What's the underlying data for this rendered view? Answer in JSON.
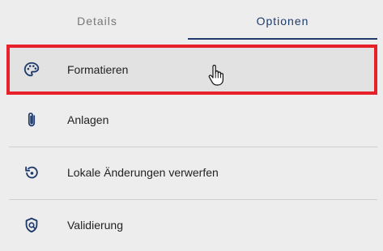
{
  "tabs": {
    "details": "Details",
    "options": "Optionen"
  },
  "items": [
    {
      "label": "Formatieren",
      "icon": "palette-icon"
    },
    {
      "label": "Anlagen",
      "icon": "paperclip-icon"
    },
    {
      "label": "Lokale Änderungen verwerfen",
      "icon": "discard-changes-icon"
    },
    {
      "label": "Validierung",
      "icon": "shield-check-icon"
    }
  ],
  "colors": {
    "accent": "#1f3b6b",
    "highlight_border": "#e8202a",
    "background": "#ededed"
  }
}
